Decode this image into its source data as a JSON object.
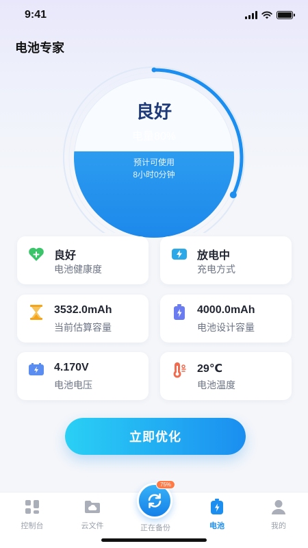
{
  "status_bar": {
    "time": "9:41"
  },
  "header": {
    "title": "电池专家"
  },
  "gauge": {
    "status": "良好",
    "level_text": "电量80%",
    "level_fraction": 0.8,
    "estimate_line1": "预计可使用",
    "estimate_line2": "8小时0分钟"
  },
  "cards": [
    {
      "value": "良好",
      "label": "电池健康度",
      "icon": "heart-icon",
      "color": "#3cc46b"
    },
    {
      "value": "放电中",
      "label": "充电方式",
      "icon": "lightning-icon",
      "color": "#2aa8e8"
    },
    {
      "value": "3532.0mAh",
      "label": "当前估算容量",
      "icon": "hourglass-icon",
      "color": "#f3a41b"
    },
    {
      "value": "4000.0mAh",
      "label": "电池设计容量",
      "icon": "battery-charge-icon",
      "color": "#6a7cf0"
    },
    {
      "value": "4.170V",
      "label": "电池电压",
      "icon": "voltage-icon",
      "color": "#5b8df0"
    },
    {
      "value": "29℃",
      "label": "电池温度",
      "icon": "thermometer-icon",
      "color": "#f06a4e"
    }
  ],
  "action": {
    "optimize_label": "立即优化"
  },
  "tabbar": {
    "tabs": [
      {
        "label": "控制台",
        "icon": "dashboard-icon"
      },
      {
        "label": "云文件",
        "icon": "cloud-folder-icon"
      },
      {
        "label": "正在备份",
        "icon": "sync-icon",
        "badge": "75%"
      },
      {
        "label": "电池",
        "icon": "battery-icon",
        "active": true
      },
      {
        "label": "我的",
        "icon": "user-icon"
      }
    ]
  },
  "colors": {
    "accent": "#1b8ef0",
    "gauge_fill": "#2c9cf0",
    "status_text": "#1e3a78"
  }
}
